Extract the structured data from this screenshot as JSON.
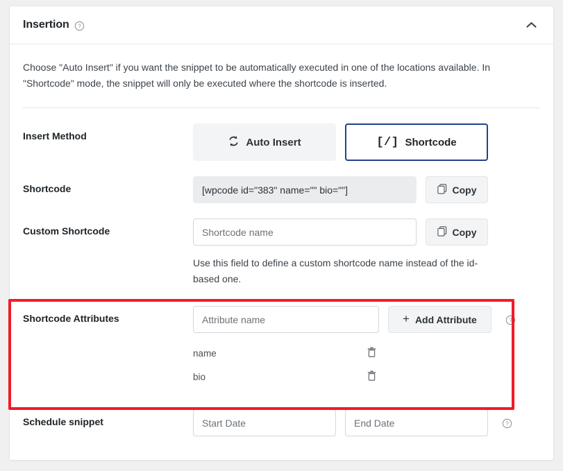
{
  "card": {
    "title": "Insertion",
    "help_icon": "question-circle-icon",
    "collapse_icon": "chevron-up-icon",
    "intro": "Choose \"Auto Insert\" if you want the snippet to be automatically executed in one of the locations available. In \"Shortcode\" mode, the snippet will only be executed where the shortcode is inserted."
  },
  "insert_method": {
    "label": "Insert Method",
    "options": [
      {
        "label": "Auto Insert",
        "icon": "sync-arrows-icon",
        "selected": false
      },
      {
        "label": "Shortcode",
        "icon": "code-brackets-glyph",
        "glyph": "[/]",
        "selected": true
      }
    ]
  },
  "shortcode": {
    "label": "Shortcode",
    "value": "[wpcode id=\"383\" name=\"\" bio=\"\"]",
    "copy_label": "Copy",
    "copy_icon": "copy-icon"
  },
  "custom_shortcode": {
    "label": "Custom Shortcode",
    "placeholder": "Shortcode name",
    "value": "",
    "copy_label": "Copy",
    "copy_icon": "copy-icon",
    "hint": "Use this field to define a custom shortcode name instead of the id-based one."
  },
  "shortcode_attributes": {
    "label": "Shortcode Attributes",
    "placeholder": "Attribute name",
    "value": "",
    "add_label": "Add Attribute",
    "add_icon": "plus-icon",
    "help_icon": "question-circle-icon",
    "items": [
      {
        "name": "name",
        "delete_icon": "trash-icon"
      },
      {
        "name": "bio",
        "delete_icon": "trash-icon"
      }
    ]
  },
  "schedule": {
    "label": "Schedule snippet",
    "start_placeholder": "Start Date",
    "start_value": "",
    "end_placeholder": "End Date",
    "end_value": "",
    "help_icon": "question-circle-icon"
  },
  "highlight": {
    "color": "#f01c27",
    "target": "shortcode-attributes-row"
  }
}
